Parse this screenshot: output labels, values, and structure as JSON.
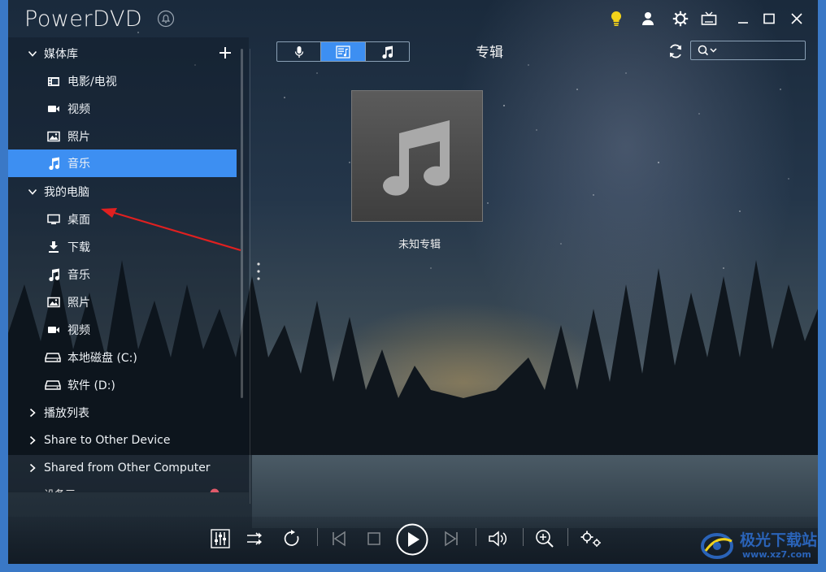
{
  "app": {
    "title": "PowerDVD"
  },
  "window_controls": [
    "tip-bulb-icon",
    "account-icon",
    "settings-gear-icon",
    "tv-mode-icon",
    "minimize-icon",
    "maximize-icon",
    "close-icon"
  ],
  "sidebar": {
    "media_library": {
      "label": "媒体库",
      "expanded": true,
      "items": [
        {
          "label": "电影/电视",
          "icon": "film-icon"
        },
        {
          "label": "视频",
          "icon": "video-camera-icon"
        },
        {
          "label": "照片",
          "icon": "photo-icon"
        },
        {
          "label": "音乐",
          "icon": "music-note-icon",
          "selected": true
        }
      ]
    },
    "my_computer": {
      "label": "我的电脑",
      "expanded": true,
      "items": [
        {
          "label": "桌面",
          "icon": "monitor-icon"
        },
        {
          "label": "下载",
          "icon": "download-icon"
        },
        {
          "label": "音乐",
          "icon": "music-note-icon"
        },
        {
          "label": "照片",
          "icon": "photo-icon"
        },
        {
          "label": "视频",
          "icon": "video-camera-icon"
        },
        {
          "label": "本地磁盘 (C:)",
          "icon": "drive-icon"
        },
        {
          "label": "软件 (D:)",
          "icon": "drive-icon"
        }
      ]
    },
    "collapsed_sections": [
      {
        "label": "播放列表"
      },
      {
        "label": "Share to Other Device"
      },
      {
        "label": "Shared from Other Computer"
      }
    ],
    "cut_off_item": {
      "label": "设备三"
    }
  },
  "view": {
    "title": "专辑",
    "modes": [
      "microphone-icon",
      "album-view-icon",
      "music-note-icon"
    ],
    "active_mode": 1,
    "album": {
      "label": "未知专辑"
    }
  },
  "colors": {
    "accent": "#3d8ff2",
    "annotation_arrow": "#e02020"
  },
  "watermark": {
    "text": "极光下载站",
    "sub": "www.xz7.com"
  }
}
